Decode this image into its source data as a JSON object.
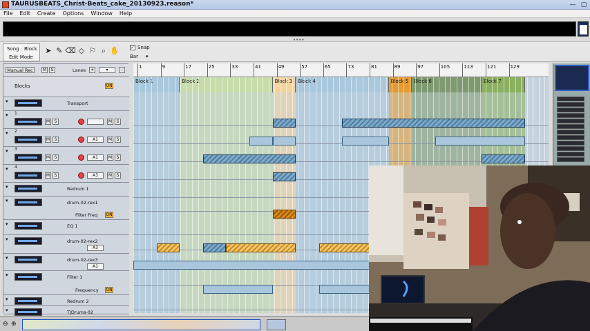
{
  "app": {
    "title": "TAURUSBEATS_Christ-Beats_cake_20130923.reason*"
  },
  "menu": [
    "File",
    "Edit",
    "Create",
    "Options",
    "Window",
    "Help"
  ],
  "toolbar": {
    "mode_tabs": [
      "Song",
      "Block"
    ],
    "edit_mode": "Edit Mode",
    "snap_label": "Snap",
    "snap_value": "Bar",
    "snap_checked": true
  },
  "track_header": {
    "manual_rec": "Manual Rec",
    "m": "M",
    "s": "S",
    "lanes": "Lanes",
    "blocks": "Blocks",
    "on": "ON"
  },
  "ruler": {
    "marks": [
      "1",
      "9",
      "17",
      "25",
      "33",
      "41",
      "49",
      "57",
      "65",
      "73",
      "81",
      "89",
      "97",
      "105",
      "113",
      "121",
      "129"
    ]
  },
  "blocks": [
    {
      "name": "Block 1",
      "color": "#a9c8dc"
    },
    {
      "name": "Block 2",
      "color": "#c8dcaa"
    },
    {
      "name": "Block 3",
      "color": "#f4d49a"
    },
    {
      "name": "Block 4",
      "color": "#a9c8dc"
    },
    {
      "name": "Block 5",
      "color": "#e39a30"
    },
    {
      "name": "Block 6",
      "color": "#7f9a70"
    },
    {
      "name": "Block 7",
      "color": "#8bb060"
    }
  ],
  "tracks": [
    {
      "name": "Transport"
    },
    {
      "num": "1",
      "note": "",
      "sel": ""
    },
    {
      "num": "2",
      "note": "A1",
      "sel": ""
    },
    {
      "num": "3",
      "note": "A1",
      "sel": ""
    },
    {
      "num": "4",
      "note": "A3",
      "sel": ""
    },
    {
      "name": "Redrum 1"
    },
    {
      "name": "drum-02-rex1",
      "param": "Filter Freq"
    },
    {
      "name": "EQ 1"
    },
    {
      "name": "drum-02-rex2",
      "note": "A3"
    },
    {
      "name": "drum-02-rex3",
      "note": "A1"
    },
    {
      "name": "Filter 1",
      "param": "Frequency"
    },
    {
      "name": "Redrum 2"
    },
    {
      "name": "TJDrums-02"
    }
  ]
}
